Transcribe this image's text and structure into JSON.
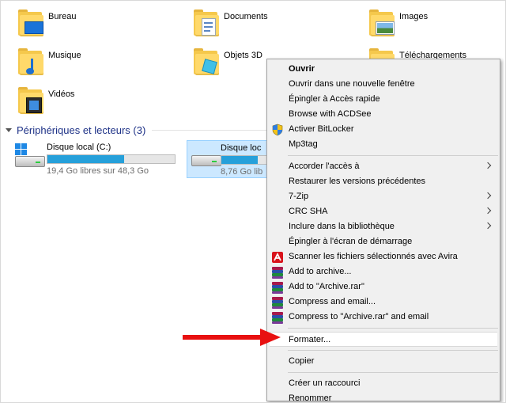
{
  "folders": [
    {
      "name": "Bureau"
    },
    {
      "name": "Documents"
    },
    {
      "name": "Images"
    },
    {
      "name": "Musique"
    },
    {
      "name": "Objets 3D"
    },
    {
      "name": "Téléchargements"
    },
    {
      "name": "Vidéos"
    }
  ],
  "devices_section": {
    "title": "Périphériques et lecteurs (3)"
  },
  "drives": [
    {
      "name": "Disque local (C:)",
      "free": "19,4 Go libres sur 48,3 Go",
      "used_fraction": 0.6
    },
    {
      "name": "Disque loc",
      "free": "8,76 Go lib",
      "used_fraction": 0.8
    }
  ],
  "context_menu": {
    "items": [
      {
        "label": "Ouvrir"
      },
      {
        "label": "Ouvrir dans une nouvelle fenêtre"
      },
      {
        "label": "Épingler à Accès rapide"
      },
      {
        "label": "Browse with ACDSee"
      },
      {
        "label": "Activer BitLocker"
      },
      {
        "label": "Mp3tag"
      },
      {
        "label": "Accorder l'accès à"
      },
      {
        "label": "Restaurer les versions précédentes"
      },
      {
        "label": "7-Zip"
      },
      {
        "label": "CRC SHA"
      },
      {
        "label": "Inclure dans la bibliothèque"
      },
      {
        "label": "Épingler à l'écran de démarrage"
      },
      {
        "label": "Scanner les fichiers sélectionnés avec Avira"
      },
      {
        "label": "Add to archive..."
      },
      {
        "label": "Add to \"Archive.rar\""
      },
      {
        "label": "Compress and email..."
      },
      {
        "label": "Compress to \"Archive.rar\" and email"
      },
      {
        "label": "Formater..."
      },
      {
        "label": "Copier"
      },
      {
        "label": "Créer un raccourci"
      },
      {
        "label": "Renommer"
      }
    ]
  },
  "colors": {
    "section_title": "#1e3287",
    "selection_bg": "#cce8ff",
    "drive_bar_fill": "#26a0da",
    "pointer_arrow": "#e81010"
  }
}
